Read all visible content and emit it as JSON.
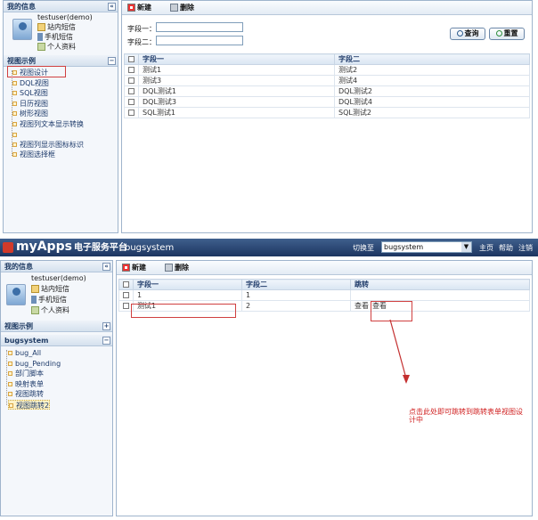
{
  "top": {
    "my_info": "我的信息",
    "user": "testuser(demo)",
    "links": [
      "站内短信",
      "手机短信",
      "个人资料"
    ],
    "view_section": "视图示例",
    "tree": [
      "视图设计",
      "DQL视图",
      "SQL视图",
      "日历视图",
      "树形视图",
      "视图列文本显示转换",
      "",
      "视图列显示图标标识",
      "视图选择框"
    ],
    "toolbar": {
      "new": "新建",
      "delete": "删除"
    },
    "fields": [
      {
        "label": "字段一："
      },
      {
        "label": "字段二："
      }
    ],
    "query": "查询",
    "reset": "重置",
    "columns": [
      "字段一",
      "字段二"
    ],
    "rows": [
      [
        "测试1",
        "测试2"
      ],
      [
        "测试3",
        "测试4"
      ],
      [
        "DQL测试1",
        "DQL测试2"
      ],
      [
        "DQL测试3",
        "DQL测试4"
      ],
      [
        "SQL测试1",
        "SQL测试2"
      ]
    ]
  },
  "bottom": {
    "logo": "myApps",
    "platform": "电子服务平台",
    "app_name": "bugsystem",
    "switch_label": "切换至",
    "switch_value": "bugsystem",
    "nav": [
      "主页",
      "帮助",
      "注销"
    ],
    "my_info": "我的信息",
    "user": "testuser(demo)",
    "links": [
      "站内短信",
      "手机短信",
      "个人资料"
    ],
    "view_section": "视图示例",
    "bug_section": "bugsystem",
    "tree": [
      "bug_All",
      "bug_Pending",
      "部门脚本",
      "映射表单",
      "视图跳转",
      "视图跳转2"
    ],
    "toolbar": {
      "new": "新建",
      "delete": "删除"
    },
    "columns": [
      "字段一",
      "字段二",
      "跳转"
    ],
    "rows": [
      [
        "1",
        "1",
        ""
      ],
      [
        "测试1",
        "2",
        "查看"
      ]
    ],
    "link_extra": "查看",
    "annotation": "点击此处即可跳转到跳转表单视图设计中"
  }
}
